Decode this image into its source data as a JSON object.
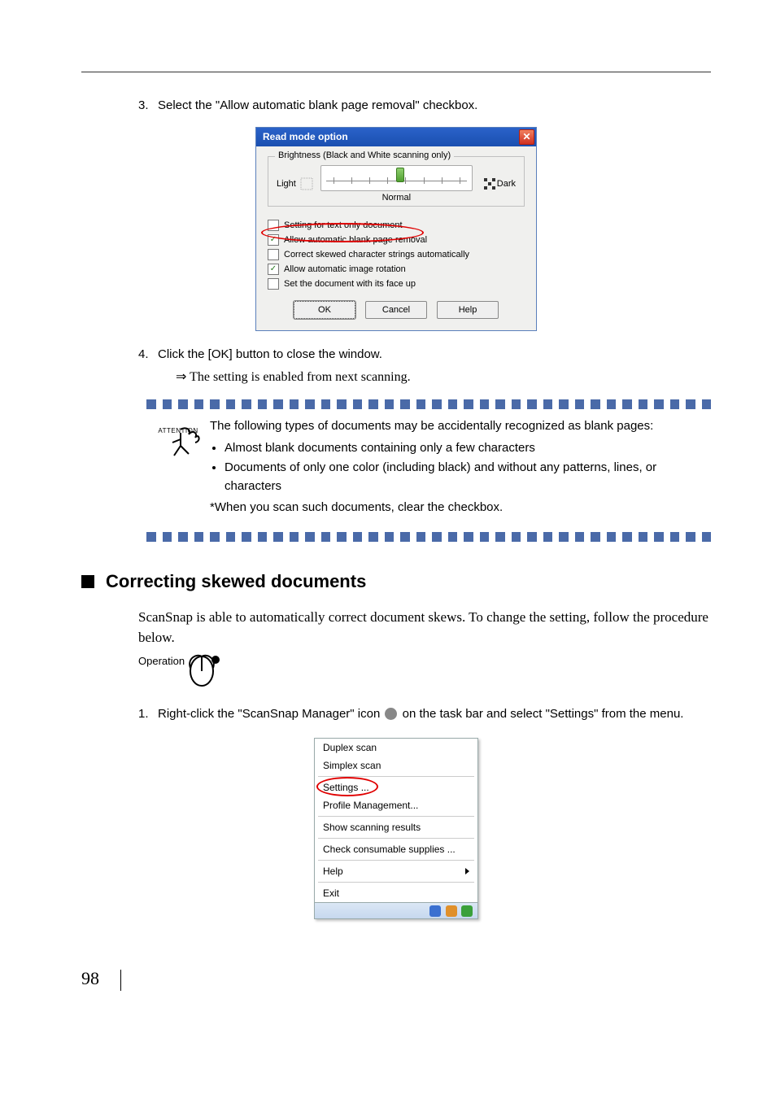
{
  "steps": {
    "s3_num": "3.",
    "s3_text": "Select the \"Allow automatic blank page removal\" checkbox.",
    "s4_num": "4.",
    "s4_text": "Click the [OK] button to close the window.",
    "s4_result_sym": "⇒",
    "s4_result_text": " The setting is enabled from next scanning."
  },
  "dialog": {
    "title": "Read mode option",
    "group_legend": "Brightness (Black and White scanning only)",
    "light_label": "Light",
    "dark_label": "Dark",
    "normal_label": "Normal",
    "opts": {
      "a": "Setting for text only document",
      "b": "Allow automatic blank page removal",
      "c": "Correct skewed character strings automatically",
      "d": "Allow automatic image rotation",
      "e": "Set the document with its face up"
    },
    "buttons": {
      "ok": "OK",
      "cancel": "Cancel",
      "help": "Help"
    }
  },
  "attention": {
    "label": "ATTENTION",
    "intro": "The following types of documents may be accidentally recognized as blank pages:",
    "b1": "Almost blank documents containing only a few characters",
    "b2": "Documents of only one color (including black) and without any patterns, lines, or characters",
    "note": "*When you scan such documents, clear the checkbox."
  },
  "heading": "Correcting skewed documents",
  "paragraph": "ScanSnap is able to automatically correct document skews. To change the setting, follow the procedure below.",
  "operation_label": "Operation",
  "step1": {
    "num": "1.",
    "text_a": "Right-click the \"ScanSnap Manager\" icon ",
    "text_b": " on the task bar and select \"Settings\" from the menu."
  },
  "menu": {
    "duplex": "Duplex scan",
    "simplex": "Simplex scan",
    "settings": "Settings ...",
    "profile": "Profile Management...",
    "show": "Show scanning results",
    "check": "Check consumable supplies ...",
    "help": "Help",
    "exit": "Exit"
  },
  "page_number": "98"
}
